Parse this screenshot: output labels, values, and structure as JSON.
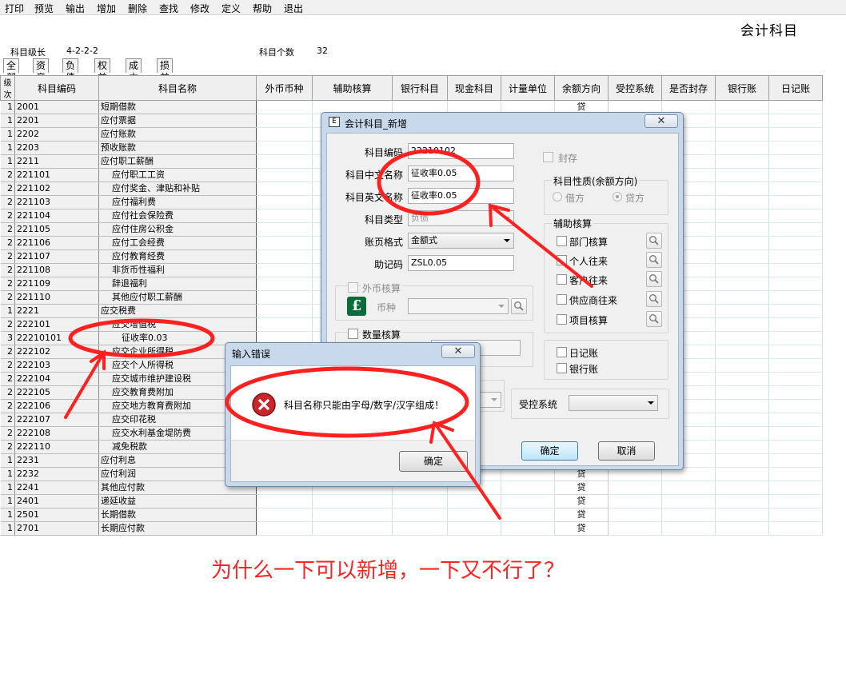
{
  "menu": [
    "打印",
    "预览",
    "输出",
    "增加",
    "删除",
    "查找",
    "修改",
    "定义",
    "帮助",
    "退出"
  ],
  "window_title": "会计科目",
  "info": {
    "level_label": "科目级长",
    "level_value": "4-2-2-2",
    "count_label": "科目个数",
    "count_value": "32"
  },
  "tabs": [
    "全部",
    "资产",
    "负债",
    "权益",
    "成本",
    "损益"
  ],
  "grid": {
    "headers": [
      "级次",
      "科目编码",
      "科目名称",
      "外币币种",
      "辅助核算",
      "银行科目",
      "现金科目",
      "计量单位",
      "余额方向",
      "受控系统",
      "是否封存",
      "银行账",
      "日记账"
    ],
    "rows": [
      [
        "1",
        "2001",
        "短期借款",
        "贷"
      ],
      [
        "1",
        "2201",
        "应付票据",
        ""
      ],
      [
        "1",
        "2202",
        "应付账款",
        ""
      ],
      [
        "1",
        "2203",
        "预收账款",
        ""
      ],
      [
        "1",
        "2211",
        "应付职工薪酬",
        ""
      ],
      [
        "2",
        "221101",
        "应付职工工资",
        ""
      ],
      [
        "2",
        "221102",
        "应付奖金、津贴和补贴",
        ""
      ],
      [
        "2",
        "221103",
        "应付福利费",
        ""
      ],
      [
        "2",
        "221104",
        "应付社会保险费",
        ""
      ],
      [
        "2",
        "221105",
        "应付住房公积金",
        ""
      ],
      [
        "2",
        "221106",
        "应付工会经费",
        ""
      ],
      [
        "2",
        "221107",
        "应付教育经费",
        ""
      ],
      [
        "2",
        "221108",
        "非货币性福利",
        ""
      ],
      [
        "2",
        "221109",
        "辞退福利",
        ""
      ],
      [
        "2",
        "221110",
        "其他应付职工薪酬",
        ""
      ],
      [
        "1",
        "2221",
        "应交税费",
        ""
      ],
      [
        "2",
        "222101",
        "应交增值税",
        ""
      ],
      [
        "3",
        "22210101",
        "征收率0.03",
        ""
      ],
      [
        "2",
        "222102",
        "应交企业所得税",
        ""
      ],
      [
        "2",
        "222103",
        "应交个人所得税",
        ""
      ],
      [
        "2",
        "222104",
        "应交城市维护建设税",
        ""
      ],
      [
        "2",
        "222105",
        "应交教育费附加",
        ""
      ],
      [
        "2",
        "222106",
        "应交地方教育费附加",
        ""
      ],
      [
        "2",
        "222107",
        "应交印花税",
        ""
      ],
      [
        "2",
        "222108",
        "应交水利基金堤防费",
        ""
      ],
      [
        "2",
        "222110",
        "减免税款",
        ""
      ],
      [
        "1",
        "2231",
        "应付利息",
        ""
      ],
      [
        "1",
        "2232",
        "应付利润",
        "贷"
      ],
      [
        "1",
        "2241",
        "其他应付款",
        "贷"
      ],
      [
        "1",
        "2401",
        "递延收益",
        "贷"
      ],
      [
        "1",
        "2501",
        "长期借款",
        "贷"
      ],
      [
        "1",
        "2701",
        "长期应付款",
        "贷"
      ]
    ]
  },
  "new_dialog": {
    "title": "会计科目_新增",
    "close": "✕",
    "code_label": "科目编码",
    "code_value": "22210102",
    "cn_name_label": "科目中文名称",
    "cn_name_value": "征收率0.05",
    "en_name_label": "科目英文名称",
    "en_name_value": "征收率0.05",
    "type_label": "科目类型",
    "type_value": "负债",
    "format_label": "账页格式",
    "format_value": "金额式",
    "mnemonic_label": "助记码",
    "mnemonic_value": "ZSL0.05",
    "foreign_group": "外币核算",
    "currency_label": "币种",
    "quantity_group": "数量核算",
    "sealed_label": "封存",
    "nature_group": "科目性质(余额方向)",
    "debit_label": "借方",
    "credit_label": "贷方",
    "aux_group": "辅助核算",
    "aux_items": [
      "部门核算",
      "个人往来",
      "客户往来",
      "供应商往来",
      "项目核算"
    ],
    "journal_label": "日记账",
    "bank_label": "银行账",
    "controlled_label": "受控系统",
    "ok": "确定",
    "cancel": "取消"
  },
  "error_dialog": {
    "title": "输入错误",
    "close": "✕",
    "message": "科目名称只能由字母/数字/汉字组成！",
    "ok": "确定"
  },
  "annotation": "为什么一下可以新增，一下又不行了？",
  "colors": {
    "annotation_red": "#ff2222",
    "dialog_frame": "#c9d9ec"
  }
}
